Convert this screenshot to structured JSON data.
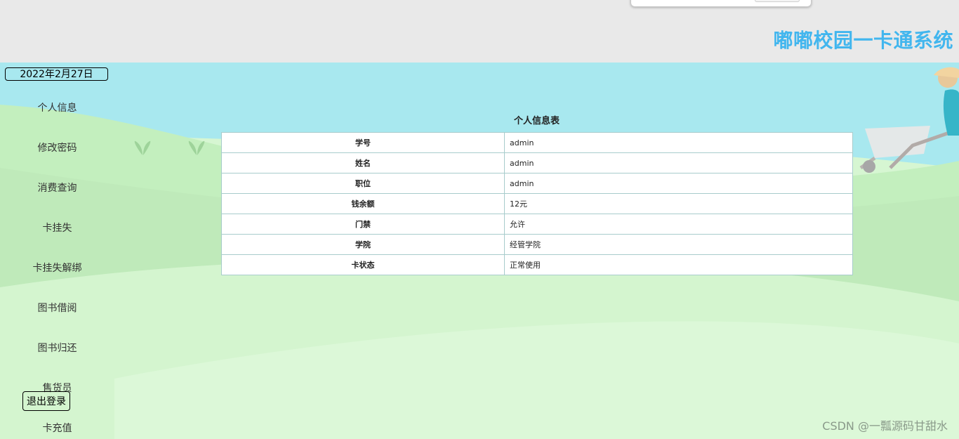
{
  "header": {
    "title": "嘟嘟校园一卡通系统"
  },
  "sidebar": {
    "date": "2022年2月27日",
    "items": [
      {
        "label": "个人信息"
      },
      {
        "label": "修改密码"
      },
      {
        "label": "消费查询"
      },
      {
        "label": "卡挂失"
      },
      {
        "label": "卡挂失解绑"
      },
      {
        "label": "图书借阅"
      },
      {
        "label": "图书归还"
      },
      {
        "label": "售货员"
      },
      {
        "label": "卡充值"
      }
    ],
    "logout_label": "退出登录"
  },
  "main": {
    "table_title": "个人信息表",
    "rows": [
      {
        "key": "学号",
        "value": "admin"
      },
      {
        "key": "姓名",
        "value": "admin"
      },
      {
        "key": "职位",
        "value": "admin"
      },
      {
        "key": "钱余额",
        "value": "12元"
      },
      {
        "key": "门禁",
        "value": "允许"
      },
      {
        "key": "学院",
        "value": "经管学院"
      },
      {
        "key": "卡状态",
        "value": "正常使用"
      }
    ]
  },
  "watermark": "CSDN @一瓢源码甘甜水",
  "colors": {
    "title": "#42b6ee",
    "header_bg": "#e9e9e9",
    "sky": "#a9e8ee",
    "grass": "#c5efc0"
  }
}
